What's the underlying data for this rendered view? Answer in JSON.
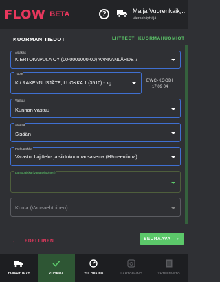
{
  "header": {
    "logo": "FLOW",
    "logo_badge": "BETA",
    "user_name": "Maija Vuorenkaik...",
    "user_role": "Vieraskäyttäjä"
  },
  "section": {
    "title": "KUORMAN TIEDOT",
    "link_attachments": "LIITTEET",
    "link_notes": "KUORMAHUOMIOT"
  },
  "fields": {
    "customer": {
      "label": "Asiakas",
      "value": "KIERTOKAPULA OY (00-0001000-00) VANKANLÄHDE 7"
    },
    "product": {
      "label": "Tuote",
      "value": "K / RAKENNUSJÄTE, LUOKKA 1 (3510) - kg"
    },
    "ewc": {
      "title": "EWC-KOODI",
      "value": "17 09 04"
    },
    "responsibility": {
      "label": "Vastuu",
      "value": "Kunnan vastuu"
    },
    "direction": {
      "label": "Suunta",
      "value": "Sisään"
    },
    "unloading": {
      "label": "Purkupaikka",
      "value": "Varasto: Lajittelu- ja siirtokuormausasema (Hämeenlinna)"
    },
    "origin": {
      "label": "Lähtöpaikka (Vapaaehtoinen)",
      "value": ""
    },
    "municipality": {
      "placeholder": "Kunta (Vapaaehtoinen)"
    }
  },
  "actions": {
    "previous": "EDELLINEN",
    "next": "SEURAAVA"
  },
  "nav": [
    {
      "label": "TAPAHTUMAT",
      "icon": "truck-icon",
      "active": false,
      "disabled": false
    },
    {
      "label": "KUORMA",
      "icon": "check-icon",
      "active": true,
      "disabled": false
    },
    {
      "label": "TULOPAINO",
      "icon": "gauge-icon",
      "active": false,
      "disabled": false
    },
    {
      "label": "LÄHTÖPAINO",
      "icon": "scale-icon",
      "active": false,
      "disabled": true
    },
    {
      "label": "YHTEENVETO",
      "icon": "document-icon",
      "active": false,
      "disabled": true
    }
  ],
  "colors": {
    "brand": "#e8375d",
    "accent_green": "#5cc86a",
    "field_border": "#3f6fd0"
  }
}
